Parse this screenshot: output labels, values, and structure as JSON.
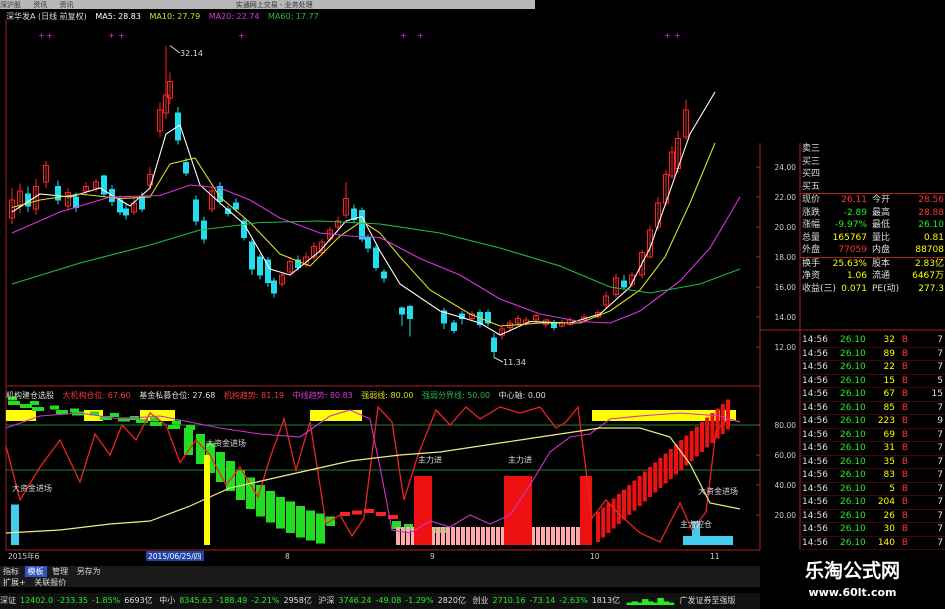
{
  "colors": {
    "up": "#ff2222",
    "down": "#22ddee",
    "ma5": "#ffffff",
    "ma10": "#dddd22",
    "ma20": "#dd33dd",
    "ma60": "#22bb44",
    "green": "#22dd22",
    "yellow": "#ffff00",
    "pink": "#ffaaaa",
    "cyan": "#44ccee",
    "panel_label": "#cccccc",
    "value": "#ffff00",
    "red_text": "#ff3333",
    "green_text": "#22ee22"
  },
  "topbar": {
    "left": "深沪股",
    "mid1": "资讯",
    "mid2": "资讯",
    "title": "实通网上交易 - 业务处理"
  },
  "ma_legend": {
    "stock": "深华发A (日线 前复权)",
    "ma5": "MA5: 28.83",
    "ma10": "MA10: 27.79",
    "ma20": "MA20: 22.74",
    "ma60": "MA60: 17.77"
  },
  "price_panel": {
    "high_label": "32.14",
    "low_label": "11.34",
    "y_labels": [
      "24.00",
      "22.00",
      "20.00",
      "18.00",
      "16.00",
      "14.00",
      "12.00"
    ]
  },
  "indicator_legend": {
    "name": "机构建仓选股",
    "inst": "大机构仓位: 67.60",
    "fund_label": "基金私募仓位: 27.68",
    "retail": "机构趋势: 81.19",
    "mid": "中线趋势: 80.83",
    "strong": "强弱线: 80.00",
    "divide": "强弱分界线: 50.00",
    "center": "中心轴: 0.00"
  },
  "indicator_panel": {
    "y_labels": [
      "80.00",
      "60.00",
      "40.00",
      "20.00"
    ],
    "ann_big_entry_1": "大资金进场",
    "ann_big_entry_2": "大资金进场",
    "ann_main_1": "主力进",
    "ann_main_2": "主力进",
    "ann_big_exit": "大资金进场",
    "ann_main_hold": "主力控仓"
  },
  "time_axis": {
    "left": "2015年6",
    "date": "2015/06/25/四",
    "m8": "8",
    "m9": "9",
    "m10": "10",
    "m11": "11"
  },
  "quote": {
    "asks": [
      "卖三",
      "买三",
      "买四",
      "买五"
    ],
    "rows": [
      {
        "l1": "现价",
        "v1": "26.11",
        "l2": "今开",
        "v2": "28.56"
      },
      {
        "l1": "涨跌",
        "v1": "-2.89",
        "l2": "最高",
        "v2": "28.88"
      },
      {
        "l1": "涨幅",
        "v1": "-9.97%",
        "l2": "最低",
        "v2": "26.10"
      },
      {
        "l1": "总量",
        "v1": "165767",
        "l2": "量比",
        "v2": "0.81"
      },
      {
        "l1": "外盘",
        "v1": "77059",
        "l2": "内盘",
        "v2": "88708"
      },
      {
        "l1": "换手",
        "v1": "25.63%",
        "l2": "股本",
        "v2": "2.83亿"
      },
      {
        "l1": "净资",
        "v1": "1.06",
        "l2": "流通",
        "v2": "6467万"
      },
      {
        "l1": "收益(三)",
        "v1": "0.071",
        "l2": "PE(动)",
        "v2": "277.3"
      }
    ]
  },
  "ticks": [
    {
      "t": "14:56",
      "p": "26.10",
      "v": "32",
      "d": "B",
      "n": "7"
    },
    {
      "t": "14:56",
      "p": "26.10",
      "v": "89",
      "d": "B",
      "n": "7"
    },
    {
      "t": "14:56",
      "p": "26.10",
      "v": "22",
      "d": "B",
      "n": "7"
    },
    {
      "t": "14:56",
      "p": "26.10",
      "v": "15",
      "d": "B",
      "n": "5"
    },
    {
      "t": "14:56",
      "p": "26.10",
      "v": "67",
      "d": "B",
      "n": "15"
    },
    {
      "t": "14:56",
      "p": "26.10",
      "v": "85",
      "d": "B",
      "n": "7"
    },
    {
      "t": "14:56",
      "p": "26.10",
      "v": "223",
      "d": "B",
      "n": "9"
    },
    {
      "t": "14:56",
      "p": "26.10",
      "v": "69",
      "d": "B",
      "n": "7"
    },
    {
      "t": "14:56",
      "p": "26.10",
      "v": "31",
      "d": "B",
      "n": "7"
    },
    {
      "t": "14:56",
      "p": "26.10",
      "v": "35",
      "d": "B",
      "n": "7"
    },
    {
      "t": "14:56",
      "p": "26.10",
      "v": "83",
      "d": "B",
      "n": "7"
    },
    {
      "t": "14:56",
      "p": "26.10",
      "v": "5",
      "d": "B",
      "n": "7"
    },
    {
      "t": "14:56",
      "p": "26.10",
      "v": "204",
      "d": "B",
      "n": "7"
    },
    {
      "t": "14:56",
      "p": "26.10",
      "v": "26",
      "d": "B",
      "n": "7"
    },
    {
      "t": "14:56",
      "p": "26.10",
      "v": "30",
      "d": "B",
      "n": "7"
    },
    {
      "t": "14:56",
      "p": "26.10",
      "v": "140",
      "d": "B",
      "n": "7"
    }
  ],
  "tabs": [
    "指标",
    "模板",
    "管理",
    "另存为"
  ],
  "subtabs": [
    "扩展+",
    "关联报价"
  ],
  "status": {
    "sz": "深证",
    "sz_val": "12402.0",
    "sz_chg": "-233.35",
    "sz_pct": "-1.85%",
    "sz_amt": "6693亿",
    "zx": "中小",
    "zx_val": "8345.63",
    "zx_chg": "-188.49",
    "zx_pct": "-2.21%",
    "zx_amt": "2958亿",
    "sh": "沪深",
    "sh_val": "3746.24",
    "sh_chg": "-49.08",
    "sh_pct": "-1.29%",
    "sh_amt": "2820亿",
    "cy": "创业",
    "cy_val": "2710.16",
    "cy_chg": "-73.14",
    "cy_pct": "-2.63%",
    "cy_amt": "1813亿",
    "broker": "广发证券至强版"
  },
  "watermark": {
    "title": "乐淘公式网",
    "url": "www.60lt.com"
  }
}
